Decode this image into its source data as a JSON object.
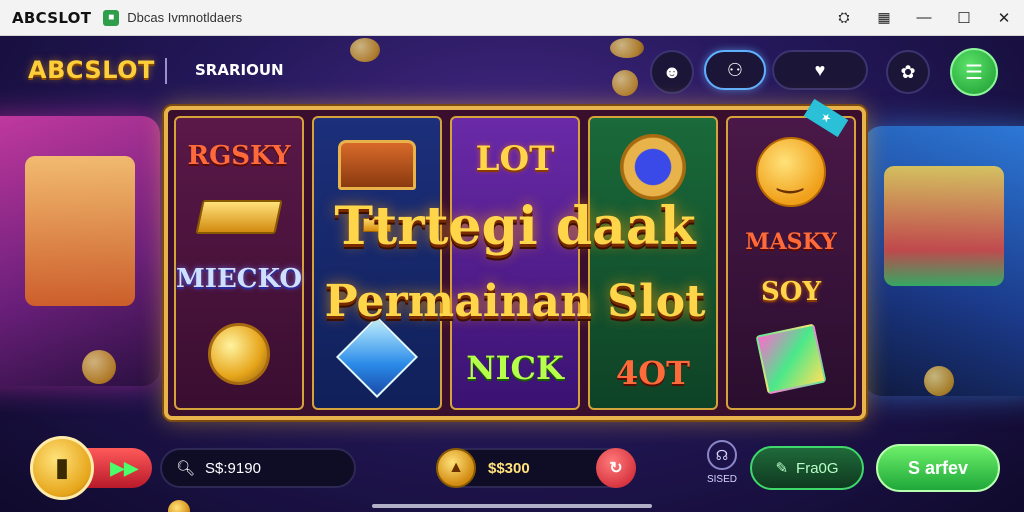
{
  "titlebar": {
    "brand": "ABCSLOT",
    "app_icon": "app-icon",
    "title": "Dbcas Ivmnotldaers",
    "actions": [
      "spy-icon",
      "chart-icon"
    ],
    "controls": [
      "minimize-icon",
      "maximize-icon",
      "close-icon"
    ]
  },
  "header": {
    "logo": "ABCSLOT",
    "section_label": "SRARIOUN",
    "icons": [
      "profile-icon",
      "people-icon",
      "heart-icon",
      "settings-icon",
      "menu-icon"
    ]
  },
  "reels": {
    "symbols": [
      [
        "RGSKY",
        "gold-bar",
        "MIECKO",
        "coin"
      ],
      [
        "chest",
        "diamond"
      ],
      [
        "LOT",
        "NICK"
      ],
      [
        "medal",
        "4OT"
      ],
      [
        "smiley",
        "MASKY",
        "SOY",
        "giftbox"
      ]
    ],
    "labels": {
      "r1_top": "RGSKY",
      "r1_mid": "MIECKO",
      "r3_top": "LOT",
      "r3_bottom": "NICK",
      "r4_bottom": "4OT",
      "r5_mid": "MASKY",
      "r5_low": "SOY"
    }
  },
  "headline": {
    "line1": "Ttrtegi daak",
    "line2": "Permainan Slot"
  },
  "bottom": {
    "search_value": "S$:9190",
    "balance_value": "$$300",
    "status_label": "SISED",
    "free_label": "Fra0G",
    "go_label": "S arfev"
  },
  "colors": {
    "accent_gold": "#ffd64a",
    "frame_gold": "#e8b34a",
    "go_green": "#1fa83a",
    "danger_red": "#c81a2a"
  }
}
